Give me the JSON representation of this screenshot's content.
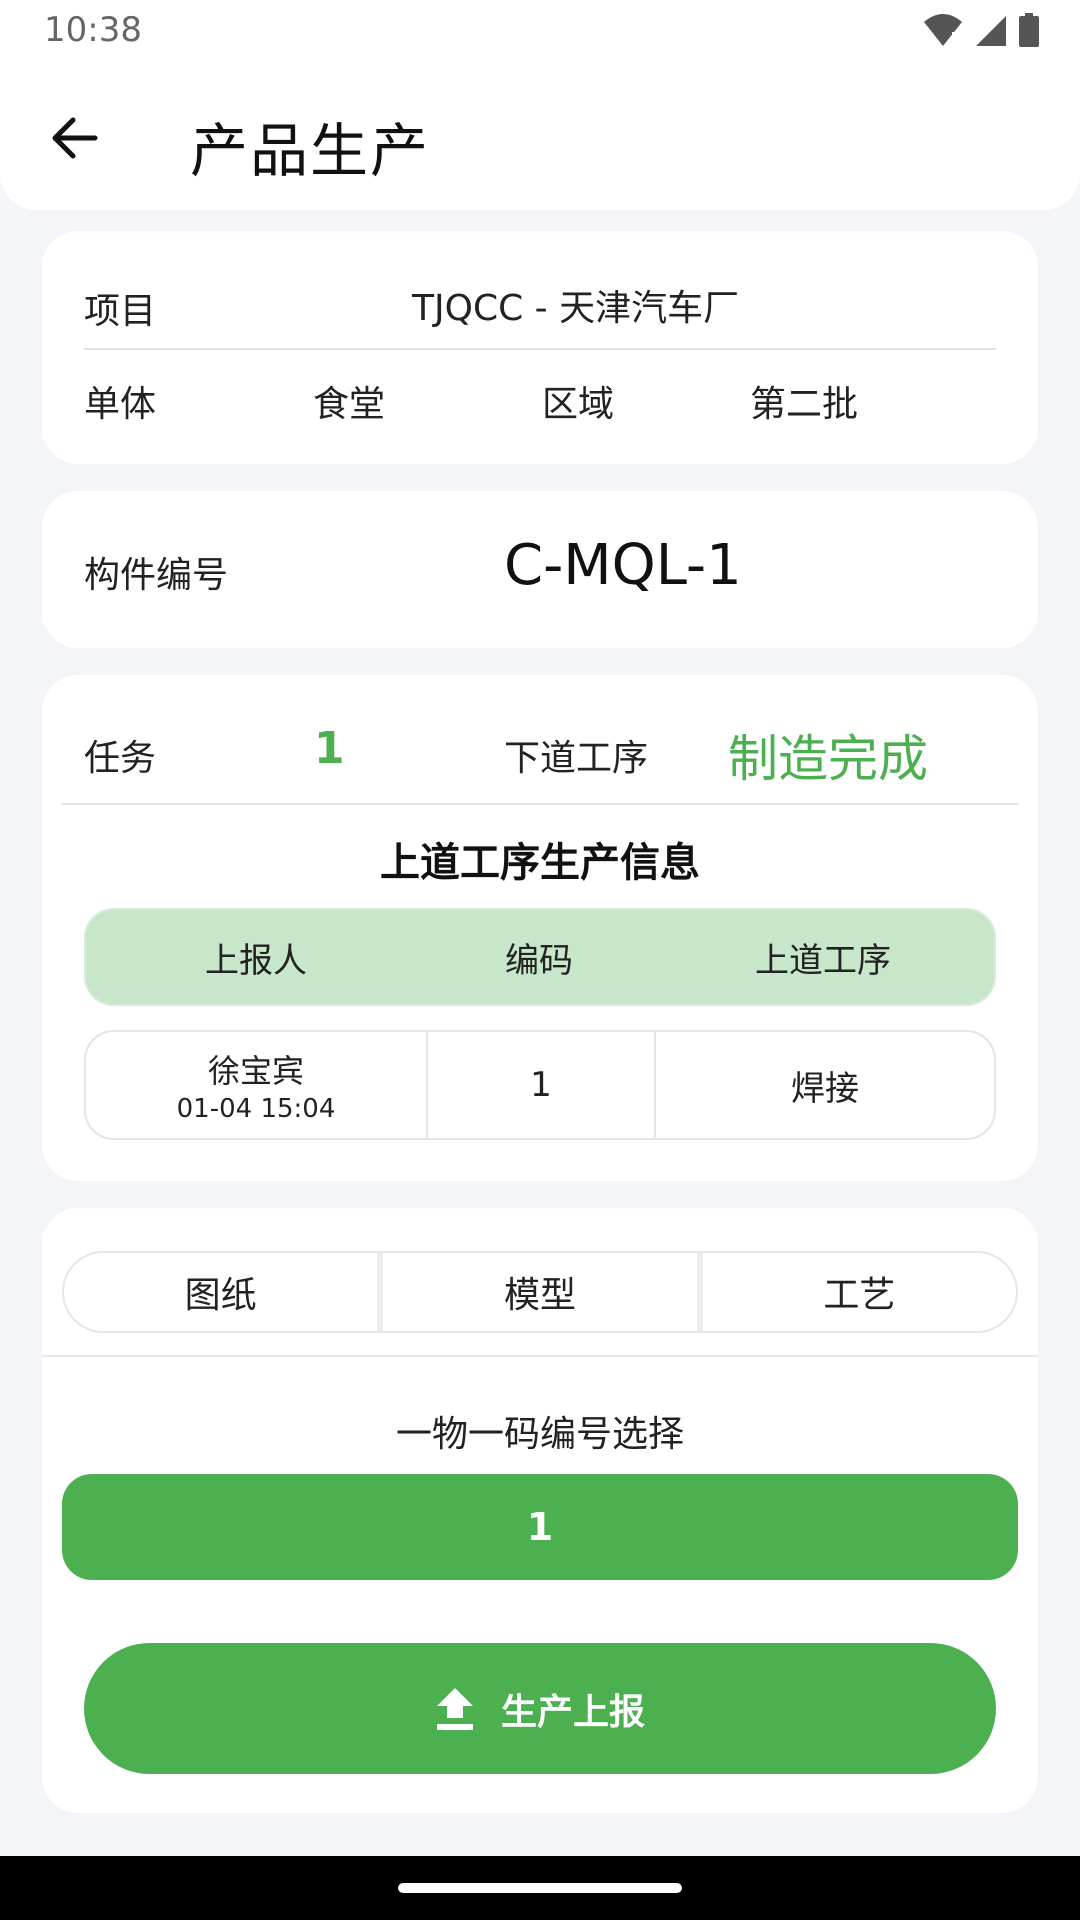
{
  "status_bar": {
    "time": "10:38"
  },
  "header": {
    "title": "产品生产"
  },
  "project_card": {
    "project_label": "项目",
    "project_value": "TJQCC - 天津汽车厂",
    "unit_label": "单体",
    "unit_value": "食堂",
    "area_label": "区域",
    "area_value": "第二批"
  },
  "component_card": {
    "label": "构件编号",
    "value": "C-MQL-1"
  },
  "task_card": {
    "task_label": "任务",
    "task_value": "1",
    "next_process_label": "下道工序",
    "next_process_value": "制造完成",
    "prev_info_title": "上道工序生产信息",
    "table": {
      "headers": [
        "上报人",
        "编码",
        "上道工序"
      ],
      "rows": [
        {
          "reporter": "徐宝宾",
          "time": "01-04 15:04",
          "code": "1",
          "process": "焊接"
        }
      ]
    }
  },
  "actions_card": {
    "tabs": [
      "图纸",
      "模型",
      "工艺"
    ],
    "code_select_label": "一物一码编号选择",
    "code_select_value": "1",
    "report_button_label": "生产上报"
  },
  "colors": {
    "accent_green": "#4caf50",
    "header_green": "#c8e6c9"
  }
}
